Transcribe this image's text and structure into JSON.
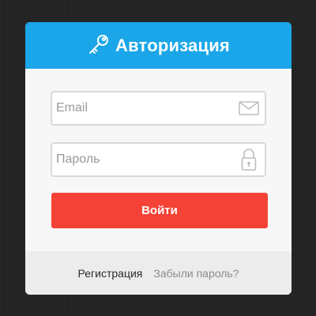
{
  "header": {
    "title": "Авторизация",
    "icon": "key-icon",
    "color": "#1aa6e8"
  },
  "form": {
    "email": {
      "placeholder": "Email",
      "value": "",
      "icon": "envelope-icon"
    },
    "password": {
      "placeholder": "Пароль",
      "value": "",
      "icon": "lock-icon"
    },
    "submit_label": "Войти",
    "submit_color": "#f44336"
  },
  "footer": {
    "register_label": "Регистрация",
    "forgot_label": "Забыли пароль?"
  }
}
